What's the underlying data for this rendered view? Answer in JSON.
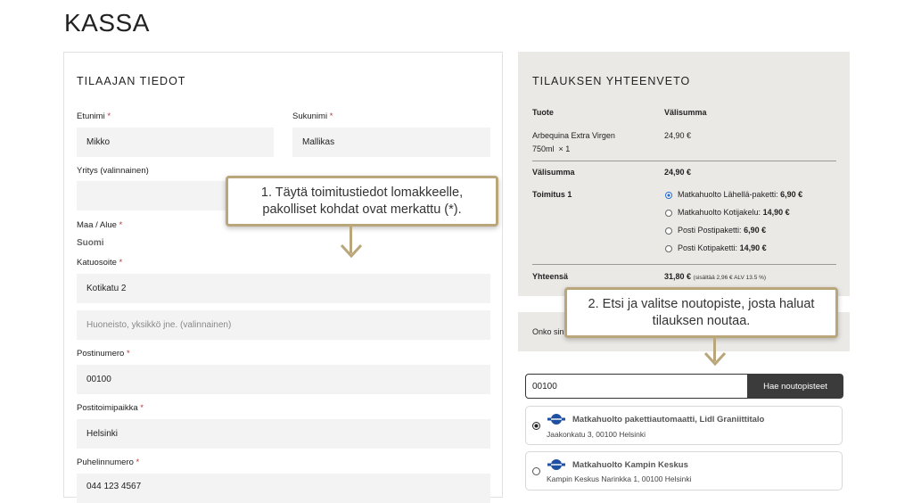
{
  "page": {
    "title": "KASSA"
  },
  "billing": {
    "heading": "TILAAJAN TIEDOT",
    "first_name": {
      "label": "Etunimi",
      "value": "Mikko"
    },
    "last_name": {
      "label": "Sukunimi",
      "value": "Mallikas"
    },
    "company": {
      "label": "Yritys (valinnainen)",
      "value": ""
    },
    "country": {
      "label": "Maa / Alue",
      "value": "Suomi"
    },
    "street": {
      "label": "Katuosoite",
      "value": "Kotikatu 2",
      "placeholder2": "Huoneisto, yksikkö jne. (valinnainen)"
    },
    "postcode": {
      "label": "Postinumero",
      "value": "00100"
    },
    "city": {
      "label": "Postitoimipaikka",
      "value": "Helsinki"
    },
    "phone": {
      "label": "Puhelinnumero",
      "value": "044 123 4567"
    },
    "required_mark": "*"
  },
  "summary": {
    "heading": "TILAUKSEN YHTEENVETO",
    "col_product": "Tuote",
    "col_subtotal": "Välisumma",
    "item_name": "Arbequina Extra Virgen",
    "item_size": "750ml",
    "item_qty": "× 1",
    "item_price": "24,90 €",
    "subtotal_label": "Välisumma",
    "subtotal_value": "24,90 €",
    "shipping_label": "Toimitus 1",
    "shipping_options": [
      {
        "name": "Matkahuolto Lähellä-paketti:",
        "price": "6,90 €",
        "selected": true
      },
      {
        "name": "Matkahuolto Kotijakelu:",
        "price": "14,90 €",
        "selected": false
      },
      {
        "name": "Posti Postipaketti:",
        "price": "6,90 €",
        "selected": false
      },
      {
        "name": "Posti Kotipaketti:",
        "price": "14,90 €",
        "selected": false
      }
    ],
    "total_label": "Yhteensä",
    "total_value": "31,80 €",
    "total_note": "(sisältää 2,96 € ALV 13.5 %)"
  },
  "pickup": {
    "info_text": "Onko sinulla",
    "search_value": "00100",
    "search_button": "Hae noutopisteet",
    "points": [
      {
        "name": "Matkahuolto pakettiautomaatti, Lidl Graniittitalo",
        "address": "Jaakonkatu 3, 00100 Helsinki",
        "selected": true
      },
      {
        "name": "Matkahuolto Kampin Keskus",
        "address": "Kampin Keskus Narinkka 1, 00100 Helsinki",
        "selected": false
      }
    ]
  },
  "callouts": {
    "one_line1": "1.  Täytä toimitustiedot lomakkeelle,",
    "one_line2": "pakolliset kohdat ovat merkattu (*).",
    "two_line1": "2. Etsi ja valitse noutopiste, josta haluat",
    "two_line2": "tilauksen noutaa."
  },
  "colors": {
    "callout_border": "#b9a67a",
    "radio_selected": "#2a6bd6",
    "button_bg": "#3b3b3b"
  }
}
